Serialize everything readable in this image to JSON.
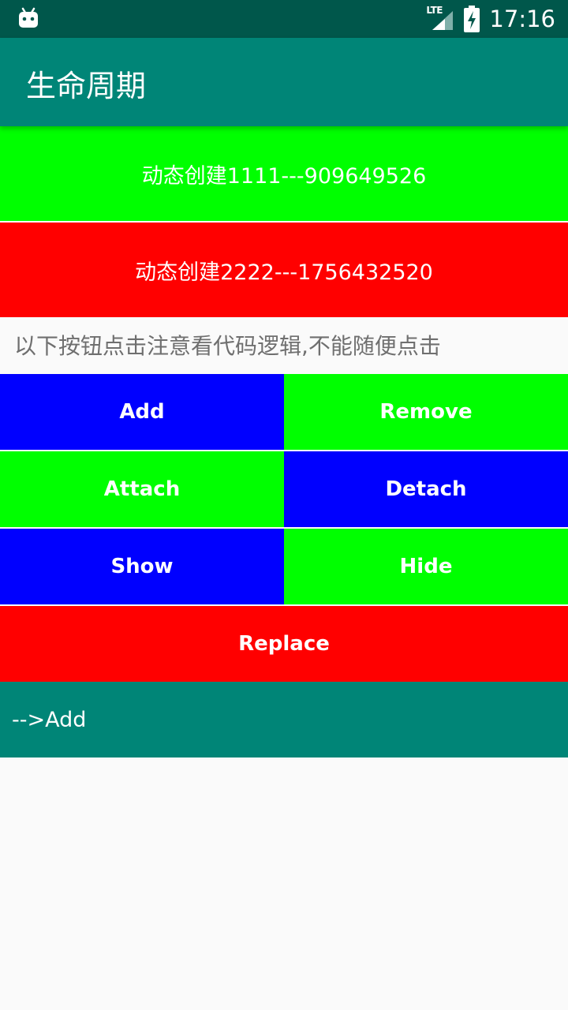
{
  "status_bar": {
    "time": "17:16",
    "network": "LTE",
    "icons": [
      "android-notification-icon",
      "lte-signal-icon",
      "battery-charging-icon"
    ]
  },
  "app_bar": {
    "title": "生命周期"
  },
  "fragments": [
    {
      "text": "动态创建1111---909649526",
      "color": "#00ff00"
    },
    {
      "text": "动态创建2222---1756432520",
      "color": "#ff0000"
    }
  ],
  "notice": "以下按钮点击注意看代码逻辑,不能随便点击",
  "buttons": {
    "add": "Add",
    "remove": "Remove",
    "attach": "Attach",
    "detach": "Detach",
    "show": "Show",
    "hide": "Hide",
    "replace": "Replace"
  },
  "log": {
    "text": "-->Add"
  },
  "colors": {
    "primary": "#008577",
    "primary_dark": "#00574b",
    "blue": "#0000ff",
    "green": "#00ff00",
    "red": "#ff0000",
    "background": "#fafafa"
  }
}
